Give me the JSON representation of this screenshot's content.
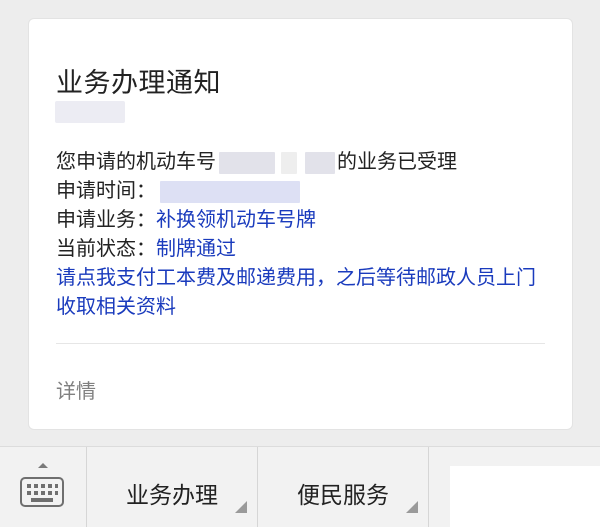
{
  "card": {
    "title": "业务办理通知",
    "line1_prefix": "您申请的机动车号",
    "line1_suffix": "的业务已受理",
    "apply_time_label": "申请时间：",
    "apply_business_label": "申请业务：",
    "apply_business_value": "补换领机动车号牌",
    "status_label": "当前状态：",
    "status_value": "制牌通过",
    "pay_link": "请点我支付工本费及邮递费用，之后等待邮政人员上门收取相关资料",
    "detail": "详情"
  },
  "menu": {
    "keyboard_icon": "keyboard-icon",
    "item1": "业务办理",
    "item2": "便民服务"
  },
  "colors": {
    "link": "#1a3bbd",
    "text": "#222222",
    "muted": "#808080",
    "background": "#ededed"
  }
}
